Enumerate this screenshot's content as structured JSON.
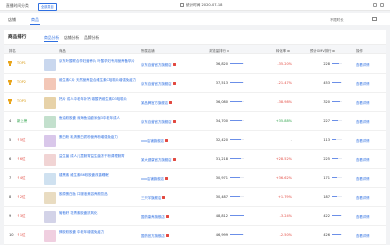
{
  "topbar": {
    "title": "直播时间分类",
    "tag": "全部类目",
    "date": "统计时间 2020-07-18"
  },
  "subbar": {
    "tabs": [
      "店铺",
      "商品"
    ],
    "active_tab": 1,
    "sort": "不限时长"
  },
  "panel": {
    "title": "商品排行",
    "tabs": [
      "商品分析",
      "店铺分析",
      "品牌分析"
    ],
    "active_tab": 0
  },
  "columns": [
    "排名",
    "商品",
    "所属店铺",
    "浏览量排行",
    "转化率",
    "预计GMV排行",
    "操作"
  ],
  "rows": [
    {
      "rank": "1",
      "medal": "gold",
      "badge": "TOP1",
      "badge_color": "gold",
      "title": "京东叶酸联合孕妇营养片 叶酸孕妇专用营养备孕片",
      "shop": "京东自营官方旗舰店",
      "views": "36,820",
      "views_pct": 0.95,
      "rate": "-35.20%",
      "rate_sign": "neg",
      "gmv": "228",
      "gmv_pct": 0.7,
      "op": "查看详情"
    },
    {
      "rank": "2",
      "medal": "gold",
      "badge": "TOP2",
      "badge_color": "gold",
      "title": "维生素C片 天然营养复合维生素C咀嚼片增强免疫力",
      "shop": "京东自营官方旗舰店",
      "views": "37,513",
      "views_pct": 0.92,
      "rate": "-21.47%",
      "rate_sign": "neg",
      "gmv": "453",
      "gmv_pct": 0.9,
      "op": "查看详情"
    },
    {
      "rank": "3",
      "medal": "gold",
      "badge": "TOP3",
      "badge_color": "gold",
      "title": "钙片 成人中老年补钙 碳酸钙维生素D3咀嚼片",
      "shop": "某品牌官方旗舰店",
      "views": "36,080",
      "views_pct": 0.88,
      "rate": "-38.98%",
      "rate_sign": "neg",
      "gmv": "320",
      "gmv_pct": 0.8,
      "op": "查看详情"
    },
    {
      "rank": "4",
      "medal": "none",
      "badge": "新上榜",
      "badge_color": "green",
      "title": "鱼油软胶囊 深海鱼油欧米伽3中老年成人",
      "shop": "京东自营官方旗舰店",
      "views": "34,700",
      "views_pct": 0.84,
      "rate": "+35.88%",
      "rate_sign": "pos",
      "gmv": "227",
      "gmv_pct": 0.62,
      "op": "查看详情"
    },
    {
      "rank": "5",
      "medal": "none",
      "badge": "↑5位",
      "badge_color": "red",
      "title": "蛋白粉 乳清蛋白质粉营养粉增强免疫力",
      "shop": "xxx店铺旗舰店",
      "views": "32,420",
      "views_pct": 0.8,
      "rate": "-",
      "rate_sign": "dash",
      "gmv": "113",
      "gmv_pct": 0.4,
      "op": "查看详情"
    },
    {
      "rank": "6",
      "medal": "none",
      "badge": "↑6位",
      "badge_color": "red",
      "title": "益生菌 成人儿童肠胃益生菌冻干粉调理肠胃",
      "shop": "某大健康官方旗舰店",
      "views": "31,218",
      "views_pct": 0.77,
      "rate": "+28.52%",
      "rate_sign": "neg",
      "gmv": "225",
      "gmv_pct": 0.58,
      "op": "查看详情"
    },
    {
      "rank": "7",
      "medal": "none",
      "badge": "↑4位",
      "badge_color": "red",
      "title": "褪黑素 维生素B6软胶囊改善睡眠",
      "shop": "xxx店铺旗舰店",
      "views": "30,971",
      "views_pct": 0.74,
      "rate": "+36.62%",
      "rate_sign": "neg",
      "gmv": "171",
      "gmv_pct": 0.46,
      "op": "查看详情"
    },
    {
      "rank": "8",
      "medal": "none",
      "badge": "↑2位",
      "badge_color": "red",
      "title": "胶原蛋白肽 口服液美容养颜饮品",
      "shop": "三只羊旗舰店",
      "views": "30,487",
      "views_pct": 0.72,
      "rate": "+1.79%",
      "rate_sign": "neg",
      "gmv": "187",
      "gmv_pct": 0.5,
      "op": "查看详情"
    },
    {
      "rank": "9",
      "medal": "none",
      "badge": "↑3位",
      "badge_color": "red",
      "title": "葡萄籽 花青素胶囊抗氧化",
      "shop": "国药康养旗舰店",
      "views": "48,812",
      "views_pct": 0.98,
      "rate": "-3.24%",
      "rate_sign": "neg",
      "gmv": "422",
      "gmv_pct": 0.86,
      "op": "查看详情"
    },
    {
      "rank": "10",
      "medal": "none",
      "badge": "↑1位",
      "badge_color": "red",
      "title": "蜂胶软胶囊 中老年增强免疫力",
      "shop": "国药官方旗舰店",
      "views": "46,999",
      "views_pct": 0.96,
      "rate": "-2.50%",
      "rate_sign": "neg",
      "gmv": "426",
      "gmv_pct": 0.87,
      "op": "查看详情"
    }
  ],
  "colors": {
    "accent": "#2f6fe0",
    "gold": "#e8a317",
    "red": "#e2483f",
    "green": "#2fa34b",
    "thumbs": [
      "#c9d7ee",
      "#f3c7b7",
      "#e7d2a8",
      "#c3e0cd",
      "#d9c7ea",
      "#f1d4d4",
      "#cfe1f0",
      "#e9dcc1",
      "#d3d3e8",
      "#f0cfe0"
    ]
  }
}
